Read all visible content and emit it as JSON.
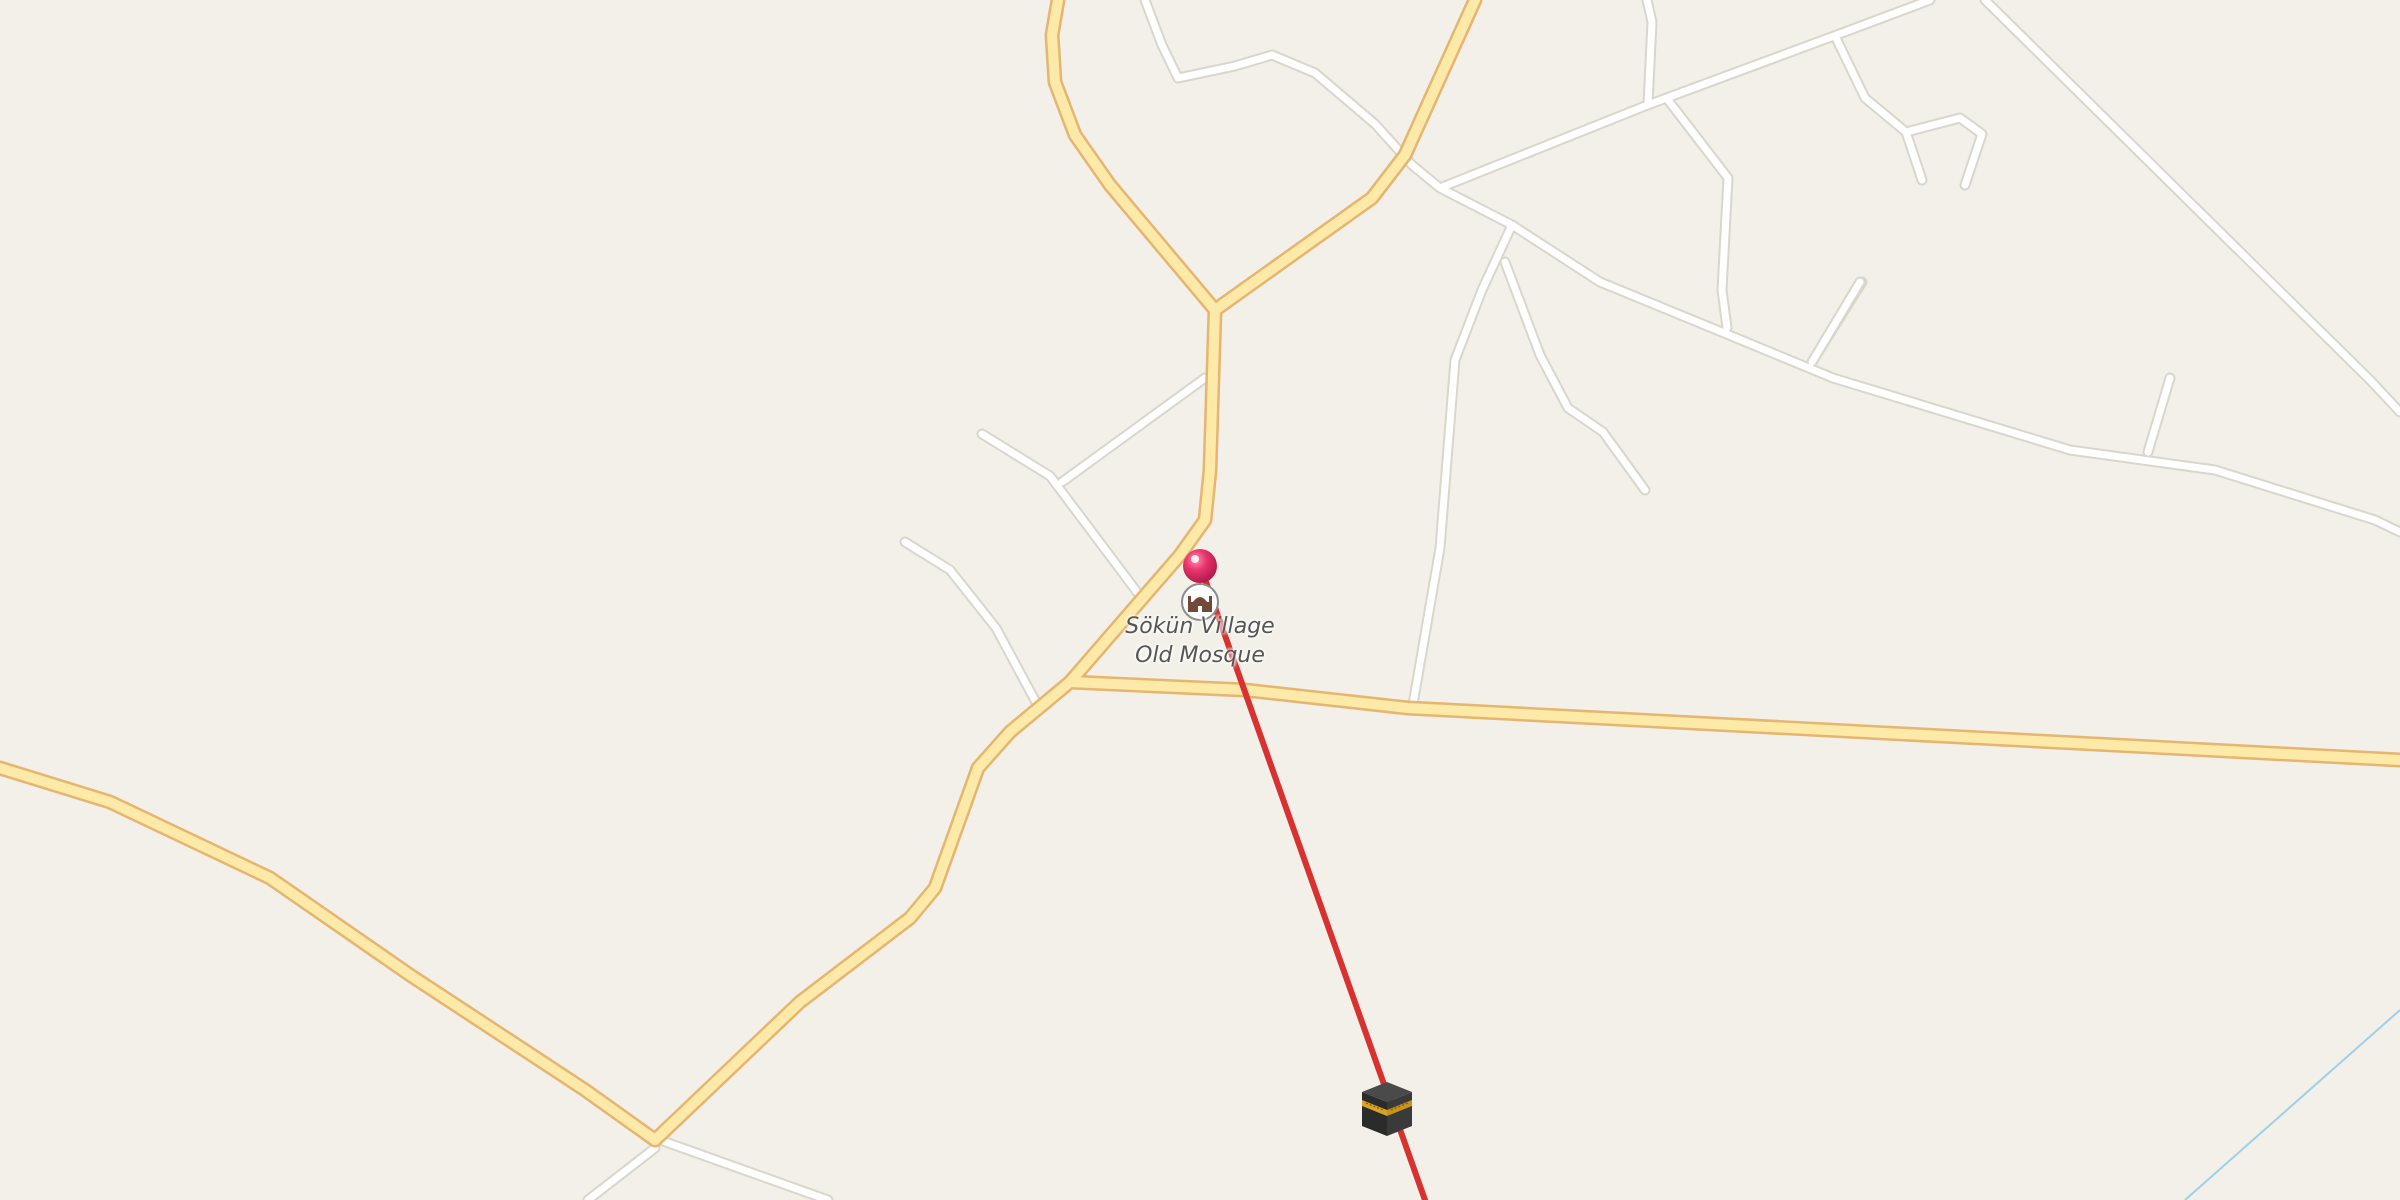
{
  "map": {
    "poi": {
      "name_line1": "Sökün Village",
      "name_line2": "Old Mosque",
      "icon": "mosque-icon"
    },
    "marker": {
      "icon": "location-pin-icon",
      "color": "#e8336b"
    },
    "destination": {
      "icon": "kaaba-icon"
    },
    "qibla_line": {
      "color": "#d93030"
    },
    "colors": {
      "land": "#f2f0e8",
      "primary_road_fill": "#fde9a8",
      "primary_road_casing": "#e6b570",
      "minor_road_fill": "#ffffff",
      "minor_road_casing": "#d9d6cc",
      "water_line": "#9fd0ea"
    }
  }
}
